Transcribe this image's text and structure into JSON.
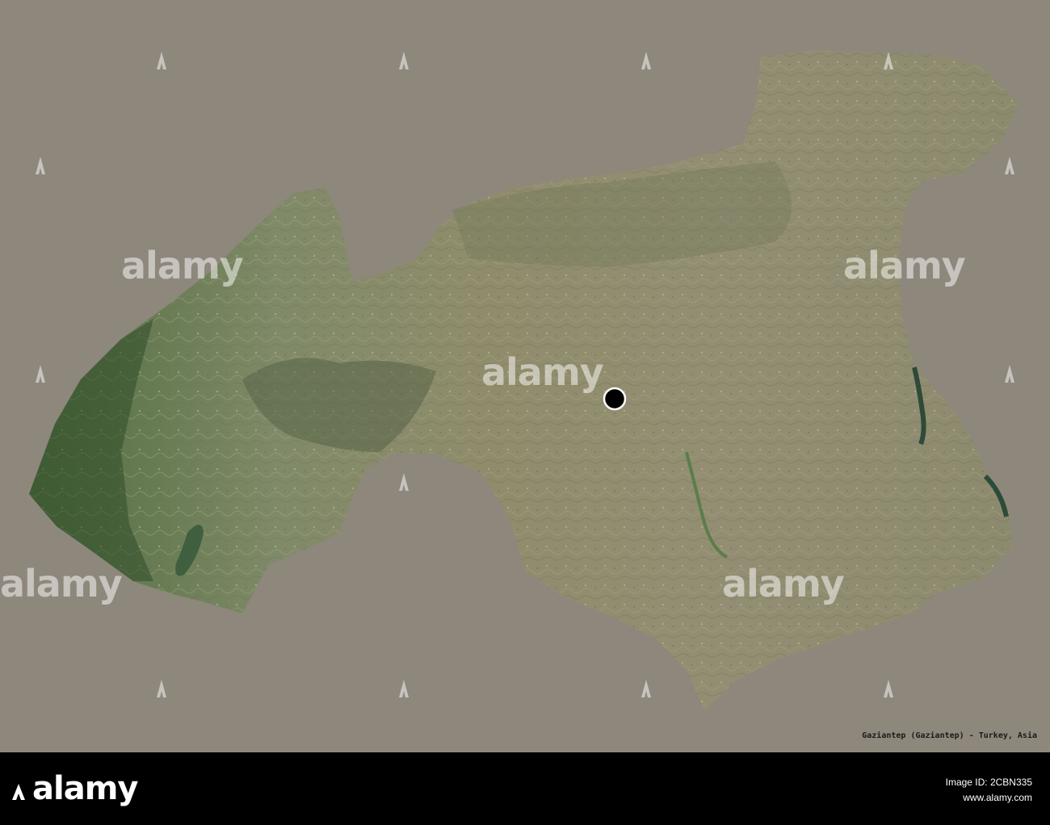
{
  "map": {
    "caption": "Gaziantep (Gaziantep) - Turkey, Asia",
    "background_color": "#8e877c",
    "capital_marker": "capital-dot-marker",
    "watermark_text": "alamy"
  },
  "footer": {
    "logo": "alamy",
    "line1": "Image ID: 2CBN335",
    "line2": "www.alamy.com"
  }
}
